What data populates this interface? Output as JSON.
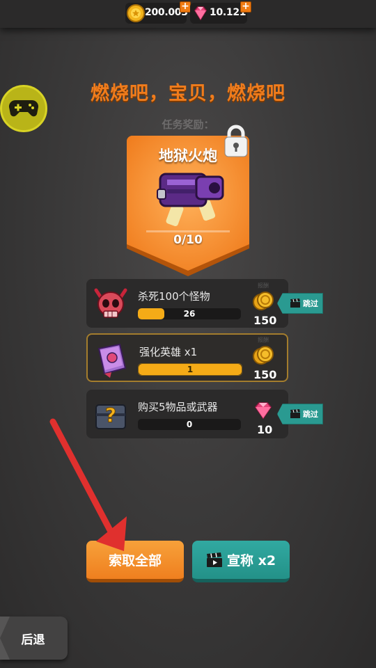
{
  "header": {
    "coins": "200.003",
    "gems": "10.121"
  },
  "quest": {
    "title": "燃烧吧，宝贝，燃烧吧",
    "reward_caption": "任务奖励：",
    "reward_name": "地狱火炮",
    "reward_progress": "0/10"
  },
  "tasks": [
    {
      "label": "杀死100个怪物",
      "progress_text": "26",
      "progress": 0.26,
      "reward_value": "150",
      "reward_type": "coin-icon",
      "small": "报酬",
      "skip_label": "跳过",
      "icon": "demon-skull-icon"
    },
    {
      "label": "强化英雄 x1",
      "progress_text": "1",
      "progress": 1.0,
      "reward_value": "150",
      "reward_type": "coin-icon",
      "small": "报酬",
      "icon": "spellbook-icon"
    },
    {
      "label": "购买5物品或武器",
      "progress_text": "0",
      "progress": 0.0,
      "reward_value": "10",
      "reward_type": "gem-icon",
      "small": "报酬",
      "skip_label": "跳过",
      "icon": "mystery-chest-icon"
    }
  ],
  "buttons": {
    "claim_all": "索取全部",
    "claim_x2": "宣称 x2",
    "back": "后退"
  },
  "colors": {
    "accent_orange": "#f07c1c",
    "teal": "#2a9a91",
    "gold": "#f5ab17",
    "arrow_red": "#e0302e"
  }
}
